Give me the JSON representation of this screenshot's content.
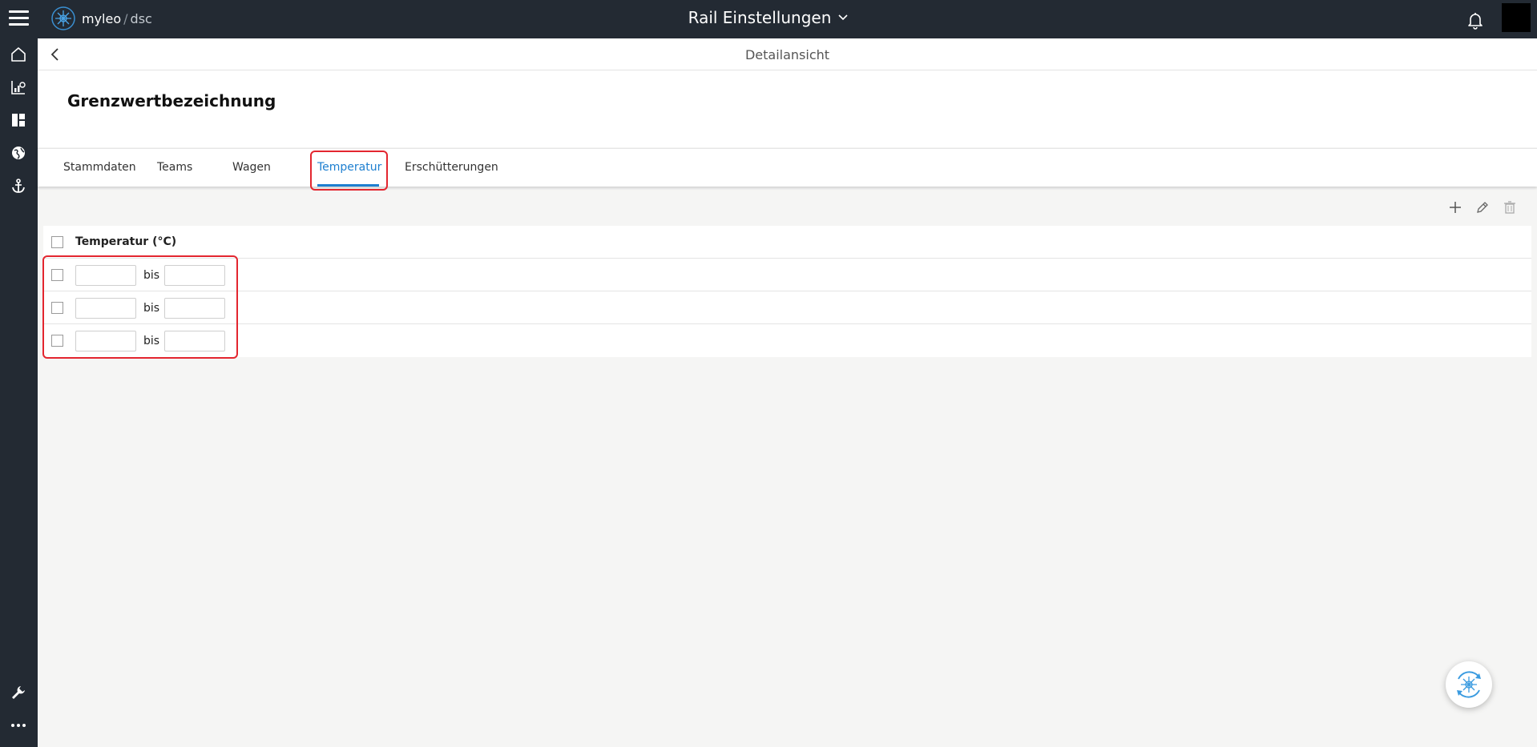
{
  "app": {
    "brand": "myleo",
    "brand_separator": "/",
    "brand_suffix": "dsc",
    "title": "Rail Einstellungen"
  },
  "detail": {
    "header": "Detailansicht",
    "title": "Grenzwertbezeichnung"
  },
  "tabs": [
    {
      "label": "Stammdaten"
    },
    {
      "label": "Teams"
    },
    {
      "label": "Wagen"
    },
    {
      "label": "Temperatur",
      "active": true
    },
    {
      "label": "Erschütterungen"
    }
  ],
  "table": {
    "column": "Temperatur (°C)",
    "separator": "bis",
    "rows": [
      {
        "from": "",
        "to": ""
      },
      {
        "from": "",
        "to": ""
      },
      {
        "from": "",
        "to": ""
      }
    ]
  },
  "nav": {
    "items": [
      "home-icon",
      "analytics-icon",
      "dashboard-icon",
      "globe-icon",
      "anchor-icon"
    ],
    "bottom": [
      "wrench-icon",
      "more-icon"
    ]
  },
  "toolbar": {
    "icons": [
      "plus-icon",
      "pencil-icon",
      "trash-icon"
    ]
  },
  "colors": {
    "topbar": "#232a33",
    "accent": "#1e7fd0",
    "highlight": "#e3262f",
    "background": "#f5f5f4"
  }
}
